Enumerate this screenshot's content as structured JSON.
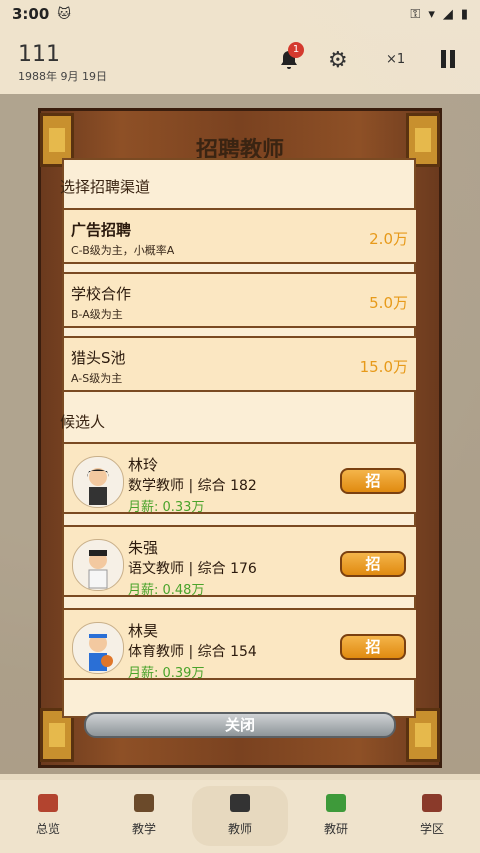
{
  "status": {
    "time": "3:00",
    "icons_right": [
      "key-icon",
      "wifi-icon",
      "signal-icon",
      "battery-icon"
    ]
  },
  "header": {
    "score": "111",
    "date": "1988年 9月 19日",
    "notification_count": "1",
    "speed": "×1"
  },
  "modal": {
    "title": "招聘教师",
    "channels_label": "选择招聘渠道",
    "channels": [
      {
        "name": "广告招聘",
        "desc": "C-B级为主，小概率A",
        "price": "2.0万"
      },
      {
        "name": "学校合作",
        "desc": "B-A级为主",
        "price": "5.0万"
      },
      {
        "name": "猎头S池",
        "desc": "A-S级为主",
        "price": "15.0万"
      }
    ],
    "candidates_label": "候选人",
    "candidates": [
      {
        "name": "林玲",
        "info": "数学教师 | 综合 182",
        "salary": "月薪: 0.33万",
        "hire_label": "招"
      },
      {
        "name": "朱强",
        "info": "语文教师 | 综合 176",
        "salary": "月薪: 0.48万",
        "hire_label": "招"
      },
      {
        "name": "林昊",
        "info": "体育教师 | 综合 154",
        "salary": "月薪: 0.39万",
        "hire_label": "招"
      }
    ],
    "close_label": "关闭"
  },
  "nav": [
    {
      "label": "总览",
      "icon": "home-icon"
    },
    {
      "label": "教学",
      "icon": "book-icon"
    },
    {
      "label": "教师",
      "icon": "teachers-icon",
      "active": true
    },
    {
      "label": "教研",
      "icon": "flask-icon"
    },
    {
      "label": "学区",
      "icon": "school-icon"
    }
  ],
  "colors": {
    "price": "#e79a1a",
    "salary": "#4aa32b",
    "hire_button": "#e08a10",
    "frame_wood": "#7a4220"
  }
}
